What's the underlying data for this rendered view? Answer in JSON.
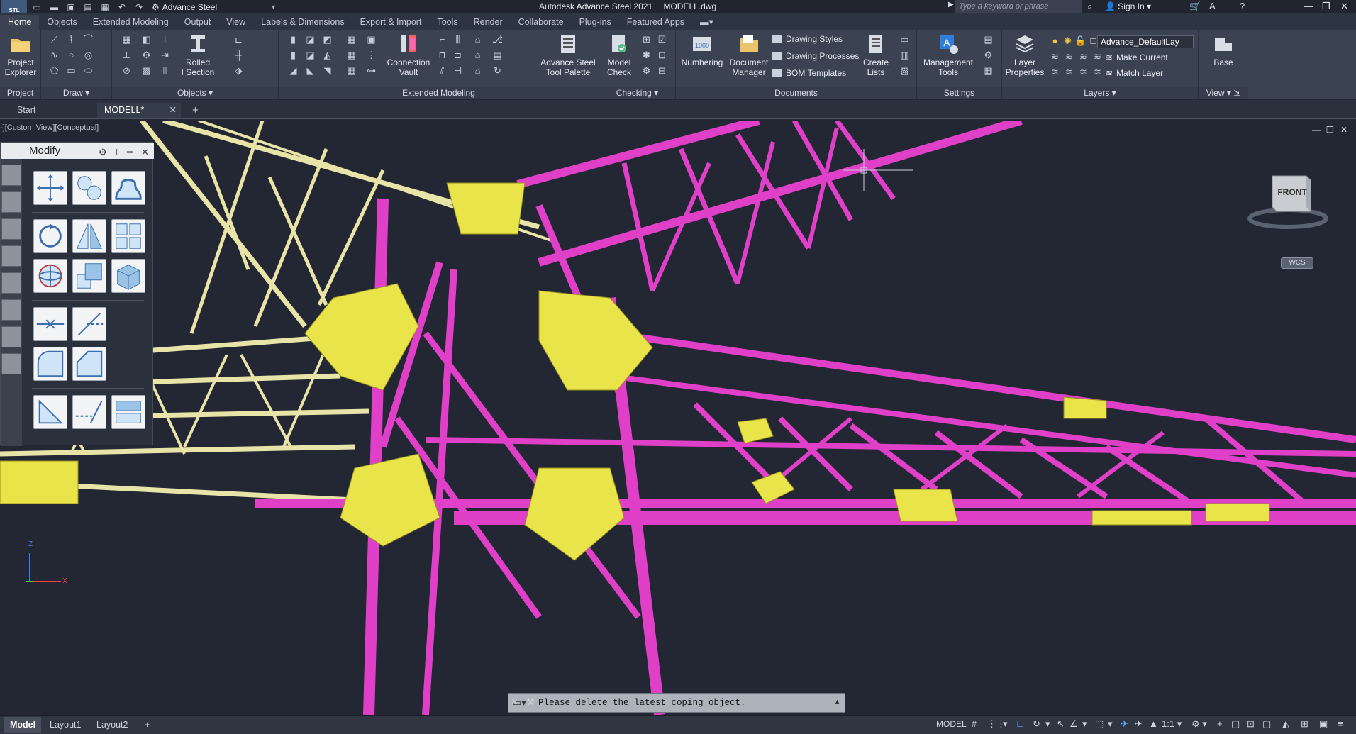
{
  "app": {
    "title": "Autodesk Advance Steel 2021",
    "file": "MODELL.dwg",
    "logo_text": "STL",
    "workspace": "Advance Steel"
  },
  "search": {
    "placeholder": "Type a keyword or phrase"
  },
  "user": {
    "signin_label": "Sign In"
  },
  "ribbon_tabs": [
    "Home",
    "Objects",
    "Extended Modeling",
    "Output",
    "View",
    "Labels & Dimensions",
    "Export & Import",
    "Tools",
    "Render",
    "Collaborate",
    "Plug-ins",
    "Featured Apps"
  ],
  "ribbon": {
    "project": {
      "btn_line1": "Project",
      "btn_line2": "Explorer",
      "label": "Project"
    },
    "draw": {
      "label": "Draw"
    },
    "objects": {
      "rolled_line1": "Rolled",
      "rolled_line2": "I Section",
      "label": "Objects"
    },
    "extended": {
      "vault_line1": "Connection",
      "vault_line2": "Vault",
      "palette_line1": "Advance Steel",
      "palette_line2": "Tool Palette",
      "label": "Extended Modeling"
    },
    "checking": {
      "btn_line1": "Model",
      "btn_line2": "Check",
      "label": "Checking"
    },
    "documents": {
      "numbering": "Numbering",
      "docman_line1": "Document",
      "docman_line2": "Manager",
      "drawing_styles": "Drawing Styles",
      "drawing_processes": "Drawing Processes",
      "bom_templates": "BOM Templates",
      "lists_line1": "Create",
      "lists_line2": "Lists",
      "label": "Documents"
    },
    "settings": {
      "btn_line1": "Management",
      "btn_line2": "Tools",
      "label": "Settings"
    },
    "layers": {
      "props_line1": "Layer",
      "props_line2": "Properties",
      "current_layer": "Advance_DefaultLay",
      "make_current": "Make Current",
      "match_layer": "Match Layer",
      "label": "Layers"
    },
    "view": {
      "base": "Base",
      "label": "View"
    }
  },
  "file_tabs": {
    "start": "Start",
    "model": "MODELL*"
  },
  "viewport": {
    "label": "-][Custom View][Conceptual]",
    "viewcube_face": "FRONT",
    "wcs": "WCS",
    "ucs_z": "Z",
    "ucs_x": "X"
  },
  "modify_palette": {
    "title": "Modify"
  },
  "command": {
    "text": "Please delete the latest coping object."
  },
  "status": {
    "layout_tabs": [
      "Model",
      "Layout1",
      "Layout2"
    ],
    "space": "MODEL",
    "scale": "1:1"
  },
  "colors": {
    "magenta": "#e040c8",
    "yellow": "#e9e44a",
    "cream": "#e8e3a6",
    "bg": "#222733",
    "accent": "#5aa6ff"
  }
}
